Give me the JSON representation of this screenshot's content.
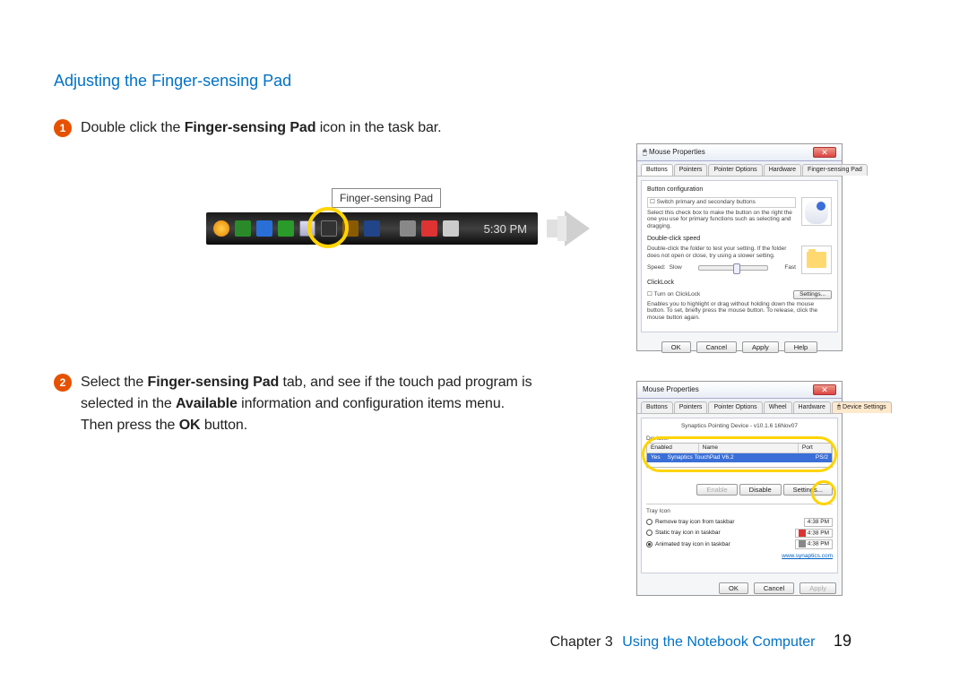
{
  "section_title": "Adjusting the Finger-sensing Pad",
  "steps": {
    "s1": {
      "num": "1",
      "pre": "Double click the ",
      "bold": "Finger-sensing Pad",
      "post": " icon in the task bar."
    },
    "s2": {
      "num": "2",
      "p1a": "Select the ",
      "p1b": "Finger-sensing Pad",
      "p1c": " tab, and see if the touch pad program is",
      "p2a": "selected in the ",
      "p2b": "Available",
      "p2c": " information and configuration items menu.",
      "p3a": "Then press the ",
      "p3b": "OK",
      "p3c": " button."
    }
  },
  "taskbar": {
    "tooltip": "Finger-sensing Pad",
    "clock": "5:30 PM"
  },
  "dialog1": {
    "title": "Mouse Properties",
    "tabs": [
      "Buttons",
      "Pointers",
      "Pointer Options",
      "Hardware",
      "Finger-sensing Pad"
    ],
    "grp1": "Button configuration",
    "swap": "Switch primary and secondary buttons",
    "swap_desc": "Select this check box to make the button on the right the one you use for primary functions such as selecting and dragging.",
    "grp2": "Double-click speed",
    "dc_desc": "Double-click the folder to test your setting. If the folder does not open or close, try using a slower setting.",
    "speed": "Speed:",
    "slow": "Slow",
    "fast": "Fast",
    "grp3": "ClickLock",
    "clk": "Turn on ClickLock",
    "clk_desc": "Enables you to highlight or drag without holding down the mouse button. To set, briefly press the mouse button. To release, click the mouse button again.",
    "btns": {
      "settings": "Settings...",
      "ok": "OK",
      "cancel": "Cancel",
      "apply": "Apply",
      "help": "Help"
    }
  },
  "dialog2": {
    "title": "Mouse Properties",
    "tabs": [
      "Buttons",
      "Pointers",
      "Pointer Options",
      "Wheel",
      "Hardware",
      "Device Settings"
    ],
    "device_line": "Synaptics Pointing Device - v10.1.6 16Nov07",
    "devices_lbl": "Devices:",
    "hdr_enabled": "Enabled",
    "hdr_name": "Name",
    "hdr_port": "Port",
    "row_enabled": "Yes",
    "row_name": "Synaptics TouchPad V6.2",
    "row_port": "PS/2",
    "enable": "Enable",
    "disable": "Disable",
    "settings": "Settings...",
    "tray": "Tray Icon",
    "opt1": "Remove tray icon from taskbar",
    "opt2": "Static tray icon in taskbar",
    "opt3": "Animated tray icon in taskbar",
    "time": "4:38 PM",
    "link": "www.synaptics.com",
    "btns": {
      "ok": "OK",
      "cancel": "Cancel",
      "apply": "Apply"
    }
  },
  "footer": {
    "chapter": "Chapter 3",
    "title": "Using the Notebook Computer",
    "page": "19"
  }
}
